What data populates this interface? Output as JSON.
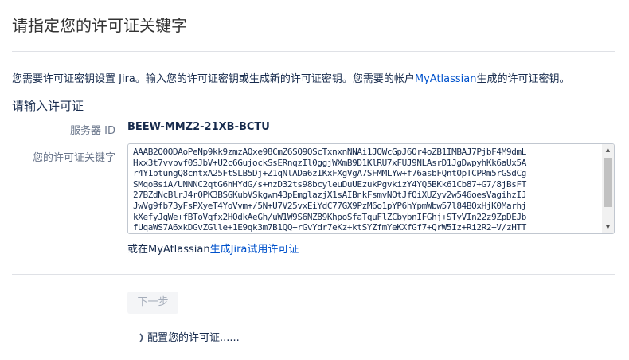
{
  "page": {
    "title": "请指定您的许可证关键字"
  },
  "description": {
    "before_link": "您需要许可证密钥设置 Jira。输入您的许可证密钥或生成新的许可证密钥。您需要的帐户",
    "link_text": "MyAtlassian",
    "after_link": "生成的许可证密钥。"
  },
  "section": {
    "title": "请输入许可证"
  },
  "server": {
    "label": "服务器 ID",
    "value": "BEEW-MMZ2-21XB-BCTU"
  },
  "license": {
    "label": "您的许可证关键字",
    "value": "AAAB2Q0ODAoPeNp9kk9zmzAQxe98CmZ6SQ9QScTxnxnNNAi1JQWcGpJ6Or4oZB1IMBAJ7PjbF4M9dmL\nHxx3t7vvpvf0SJbV+U2c6GujockSsERnqzIl0ggjWXmB9D1KlRU7xFUJ9NLAsrD1JgDwpyhKk6aUx5A\nr4Y1ptungQ8cntxA25FtSLB5Dj+Z1qNlADa6zIKxFXgVgA7SFMMLYw+f76asbFQntOpTCPRm5rGSdCg\nSMqoBsiA/UNNNC2qtG6hHYdG/s+nzD32ts98bcyleuDuUEzukPgvkizY4YQ5BKk61Cb87+G7/8jBsFT\n27BZdNcBlrJ4rOPK3BSGKubVSkgwm43pEmglazjX1sAIBnkFsmvNOtJfQiXUZyv2w546oesVagihzIJ\nJwVg9fb73yFsPXyeT4YoVvm+/5N+U7V25vxEiYdC77GX9PzM6o1pYP6hYpmWbw57l84BOxHjK0Marhj\nkXefyJqWe+fBToVqfx2HOdkAeGh/uW1W9S6NZ89KhpoSfaTquFlZCbybnIFGhj+STyVIn22z9ZpDEJb\nfUqaWS7A6xkDGvZGlle+1E9qk3m7B1QQ+rGvYdr7eKz+ktSYZfmYeKXfGf7+QrW5Iz+Ri2R2+V/zHTT"
  },
  "trial": {
    "before_link": "或在MyAtlassian",
    "link_text": "生成Jira试用许可证"
  },
  "actions": {
    "next_label": "下一步"
  },
  "status": {
    "progress_text": "配置您的许可证......"
  },
  "colors": {
    "link": "#0052cc",
    "text": "#172b4d",
    "muted_label": "#6b778c",
    "disabled_button_bg": "#f4f5f7",
    "disabled_button_text": "#a5adba"
  },
  "icons": {
    "spinner": "spinner-icon",
    "scroll_up": "scroll-up-arrow-icon",
    "scroll_down": "scroll-down-arrow-icon"
  }
}
